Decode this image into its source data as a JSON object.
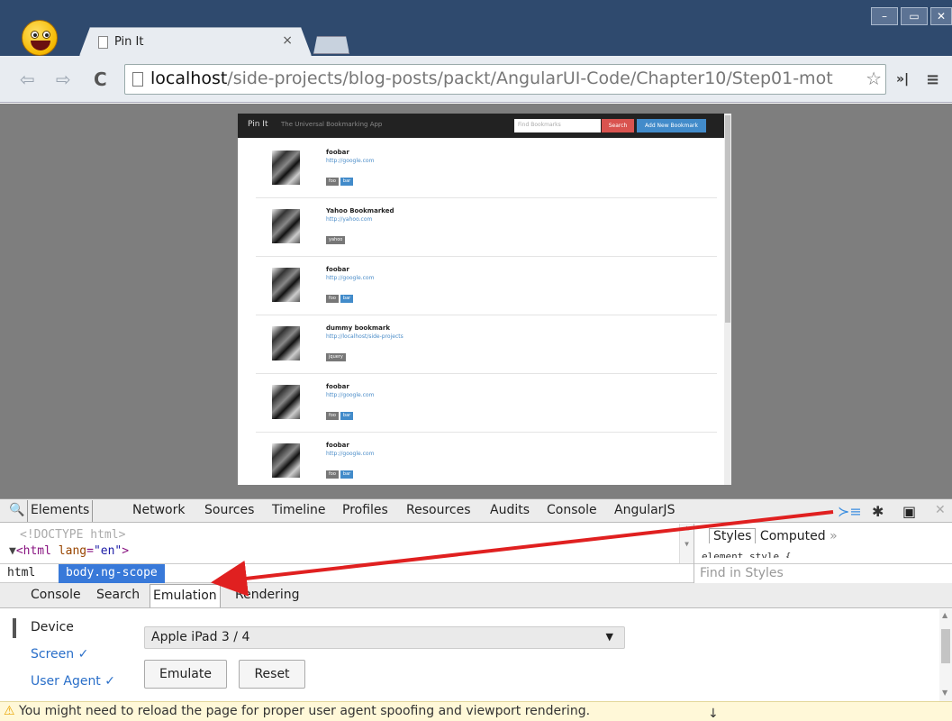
{
  "browser": {
    "tab_title": "Pin It",
    "tab_close": "×",
    "url_host": "localhost",
    "url_path": "/side-projects/blog-posts/packt/AngularUI-Code/Chapter10/Step01-mot",
    "window_controls": {
      "minimize": "–",
      "maximize": "▭",
      "close": "✕"
    },
    "icons": [
      "back-arrow-icon",
      "forward-arrow-icon",
      "reload-icon",
      "page-icon",
      "star-icon",
      "menu-icon"
    ]
  },
  "app": {
    "brand": "Pin It",
    "tagline": "The Universal Bookmarking App",
    "search_placeholder": "Find Bookmarks",
    "search_button": "Search",
    "add_button": "Add New Bookmark",
    "bookmarks": [
      {
        "title": "foobar",
        "url": "http://google.com",
        "tags": [
          {
            "label": "foo",
            "color": "#777777"
          },
          {
            "label": "bar",
            "color": "#428bca"
          }
        ]
      },
      {
        "title": "Yahoo Bookmarked",
        "url": "http://yahoo.com",
        "tags": [
          {
            "label": "yahoo",
            "color": "#777777"
          }
        ]
      },
      {
        "title": "foobar",
        "url": "http://google.com",
        "tags": [
          {
            "label": "foo",
            "color": "#777777"
          },
          {
            "label": "bar",
            "color": "#428bca"
          }
        ]
      },
      {
        "title": "dummy bookmark",
        "url": "http://localhost/side-projects",
        "tags": [
          {
            "label": "jquery",
            "color": "#777777"
          }
        ]
      },
      {
        "title": "foobar",
        "url": "http://google.com",
        "tags": [
          {
            "label": "foo",
            "color": "#777777"
          },
          {
            "label": "bar",
            "color": "#428bca"
          }
        ]
      },
      {
        "title": "foobar",
        "url": "http://google.com",
        "tags": [
          {
            "label": "foo",
            "color": "#777777"
          },
          {
            "label": "bar",
            "color": "#428bca"
          }
        ]
      }
    ]
  },
  "devtools": {
    "tabs": [
      "Elements",
      "Network",
      "Sources",
      "Timeline",
      "Profiles",
      "Resources",
      "Audits",
      "Console",
      "AngularJS"
    ],
    "active_tab": "Elements",
    "elements": {
      "doctype": "<!DOCTYPE html>",
      "html_open": "<html",
      "html_attr": "lang",
      "html_val": "\"en\"",
      "html_close": ">"
    },
    "breadcrumbs": [
      "html",
      "body.ng-scope"
    ],
    "styles_tabs": [
      "Styles",
      "Computed"
    ],
    "styles_more": "»",
    "styles_code": "element.style {",
    "find_in_styles": "Find in Styles",
    "drawer_tabs": [
      "Console",
      "Search",
      "Emulation",
      "Rendering"
    ],
    "active_drawer_tab": "Emulation",
    "emulation": {
      "side_items": [
        "Device",
        "Screen ✓",
        "User Agent ✓"
      ],
      "device_value": "Apple iPad 3 / 4",
      "emulate_button": "Emulate",
      "reset_button": "Reset"
    },
    "warning": "You might need to reload the page for proper user agent spoofing and viewport rendering."
  },
  "colors": {
    "arrow": "#e02020",
    "accent": "#3879d9"
  }
}
